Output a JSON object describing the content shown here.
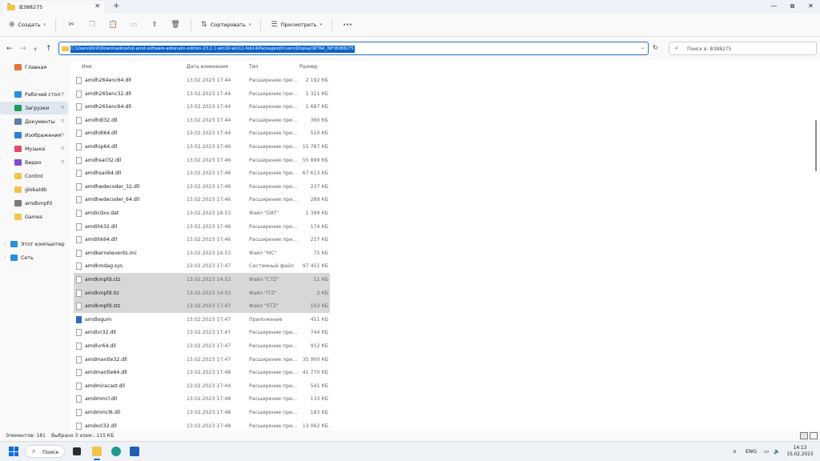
{
  "window": {
    "tab_title": "B388275",
    "close_tab": "✕",
    "new_tab": "+",
    "minimize": "—",
    "maximize": "⧉",
    "close": "✕"
  },
  "commandbar": {
    "create": "Создать",
    "sort": "Сортировать",
    "view": "Просмотреть",
    "more": "···",
    "icons": [
      "cut-icon",
      "copy-icon",
      "paste-icon",
      "rename-icon",
      "share-icon",
      "delete-icon"
    ]
  },
  "address": {
    "path": "C:\\Users\\Kirill\\Downloads\\whql-amd-software-adrenalin-edition-23.2.1-win10-win11-feb14\\Packages\\Drivers\\Display\\WT6A_INF\\B388275",
    "search_placeholder": "Поиск в: B388275"
  },
  "sidebar": {
    "items": [
      {
        "label": "Главная",
        "icon": "home-icon",
        "color": "#e8733c"
      },
      {
        "label": "Рабочий стол",
        "icon": "desktop-icon",
        "color": "#2b8fe0",
        "pinned": true
      },
      {
        "label": "Загрузки",
        "icon": "download-icon",
        "color": "#1f9a5b",
        "pinned": true,
        "selected": true
      },
      {
        "label": "Документы",
        "icon": "documents-icon",
        "color": "#5b7fa6",
        "pinned": true
      },
      {
        "label": "Изображения",
        "icon": "pictures-icon",
        "color": "#2f7fd2",
        "pinned": true
      },
      {
        "label": "Музыка",
        "icon": "music-icon",
        "color": "#e04b66",
        "pinned": true
      },
      {
        "label": "Видео",
        "icon": "video-icon",
        "color": "#7d4fd0",
        "pinned": true
      },
      {
        "label": "Control",
        "icon": "folder-icon",
        "color": "#f2c44d"
      },
      {
        "label": "globaldb",
        "icon": "folder-icon",
        "color": "#f2c44d"
      },
      {
        "label": "amdkmpfd",
        "icon": "search-icon",
        "color": "#7a7a7a"
      },
      {
        "label": "Games",
        "icon": "folder-icon",
        "color": "#f2c44d"
      },
      {
        "label": "Этот компьютер",
        "icon": "computer-icon",
        "color": "#2b8fe0",
        "expandable": true
      },
      {
        "label": "Сеть",
        "icon": "network-icon",
        "color": "#2b8fe0",
        "expandable": true
      }
    ],
    "pin_glyph": "📌"
  },
  "columns": {
    "name": "Имя",
    "date": "Дата изменения",
    "type": "Тип",
    "size": "Размер"
  },
  "files": [
    {
      "name": "amdh264enc64.dll",
      "date": "13.02.2023 17:44",
      "type": "Расширение при...",
      "size": "2 192 КБ"
    },
    {
      "name": "amdh265enc32.dll",
      "date": "13.02.2023 17:44",
      "type": "Расширение при...",
      "size": "1 321 КБ"
    },
    {
      "name": "amdh265enc64.dll",
      "date": "13.02.2023 17:44",
      "type": "Расширение при...",
      "size": "1 687 КБ"
    },
    {
      "name": "amdhdl32.dll",
      "date": "13.02.2023 17:44",
      "type": "Расширение при...",
      "size": "390 КБ"
    },
    {
      "name": "amdhdl64.dll",
      "date": "13.02.2023 17:44",
      "type": "Расширение при...",
      "size": "510 КБ"
    },
    {
      "name": "amdhip64.dll",
      "date": "13.02.2023 17:46",
      "type": "Расширение при...",
      "size": "15 787 КБ"
    },
    {
      "name": "amdhsail32.dll",
      "date": "13.02.2023 17:46",
      "type": "Расширение при...",
      "size": "55 899 КБ"
    },
    {
      "name": "amdhsail64.dll",
      "date": "13.02.2023 17:46",
      "type": "Расширение при...",
      "size": "67 613 КБ"
    },
    {
      "name": "amdhwdecoder_32.dll",
      "date": "13.02.2023 17:46",
      "type": "Расширение при...",
      "size": "237 КБ"
    },
    {
      "name": "amdhwdecoder_64.dll",
      "date": "13.02.2023 17:46",
      "type": "Расширение при...",
      "size": "289 КБ"
    },
    {
      "name": "amdicdxx.dat",
      "date": "13.02.2023 14:53",
      "type": "Файл \"DAT\"",
      "size": "1 399 КБ"
    },
    {
      "name": "amdihk32.dll",
      "date": "13.02.2023 17:46",
      "type": "Расширение при...",
      "size": "174 КБ"
    },
    {
      "name": "amdihk64.dll",
      "date": "13.02.2023 17:46",
      "type": "Расширение при...",
      "size": "217 КБ"
    },
    {
      "name": "amdkernelevents.mc",
      "date": "13.02.2023 14:53",
      "type": "Файл \"MC\"",
      "size": "75 КБ"
    },
    {
      "name": "amdkmdag.sys",
      "date": "13.02.2023 17:47",
      "type": "Системный файл",
      "size": "97 451 КБ"
    },
    {
      "name": "amdkmpfd.ctz",
      "date": "13.02.2023 14:53",
      "type": "Файл \"CTZ\"",
      "size": "11 КБ",
      "selected": true
    },
    {
      "name": "amdkmpfd.itz",
      "date": "13.02.2023 14:53",
      "type": "Файл \"ITZ\"",
      "size": "2 КБ",
      "selected": true
    },
    {
      "name": "amdkmpfd.stz",
      "date": "13.02.2023 17:47",
      "type": "Файл \"STZ\"",
      "size": "103 КБ",
      "selected": true
    },
    {
      "name": "amdlogum",
      "date": "13.02.2023 17:47",
      "type": "Приложение",
      "size": "451 КБ",
      "app": true
    },
    {
      "name": "amdlvr32.dll",
      "date": "13.02.2023 17:47",
      "type": "Расширение при...",
      "size": "744 КБ"
    },
    {
      "name": "amdlvr64.dll",
      "date": "13.02.2023 17:47",
      "type": "Расширение при...",
      "size": "912 КБ"
    },
    {
      "name": "amdmantle32.dll",
      "date": "13.02.2023 17:47",
      "type": "Расширение при...",
      "size": "35 900 КБ"
    },
    {
      "name": "amdmantle64.dll",
      "date": "13.02.2023 17:48",
      "type": "Расширение при...",
      "size": "41 770 КБ"
    },
    {
      "name": "amdmiracast.dll",
      "date": "13.02.2023 17:44",
      "type": "Расширение при...",
      "size": "541 КБ"
    },
    {
      "name": "amdmmcl.dll",
      "date": "13.02.2023 17:48",
      "type": "Расширение при...",
      "size": "133 КБ"
    },
    {
      "name": "amdmmcl6.dll",
      "date": "13.02.2023 17:48",
      "type": "Расширение при...",
      "size": "183 КБ"
    },
    {
      "name": "amdocl32.dll",
      "date": "13.02.2023 17:48",
      "type": "Расширение при...",
      "size": "13 062 КБ"
    }
  ],
  "status": {
    "count": "Элементов: 181",
    "selected": "Выбрано 3 элем.: 115 КБ"
  },
  "taskbar": {
    "search": "Поиск",
    "lang": "ENG",
    "time": "14:13",
    "date": "15.02.2023",
    "tray_icons": [
      "chevron-up-icon",
      "network-icon",
      "volume-icon",
      "battery-icon"
    ]
  }
}
